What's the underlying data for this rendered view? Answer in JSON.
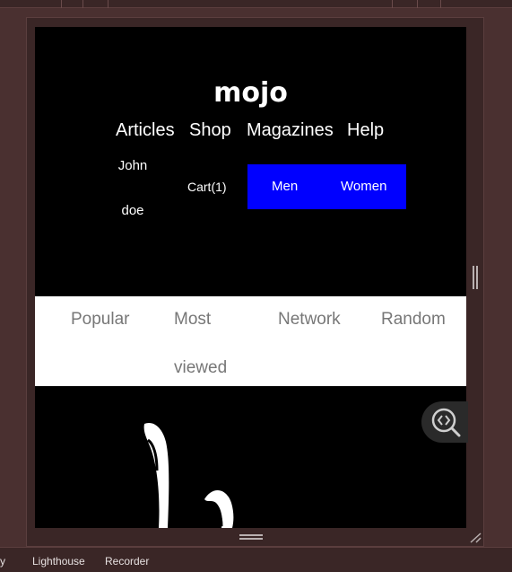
{
  "site": {
    "logo": "mojo",
    "nav": [
      "Articles",
      "Shop",
      "Magazines",
      "Help"
    ],
    "user_first": "John",
    "user_last": "doe",
    "cart": "Cart(1)",
    "gender": [
      "Men",
      "Women"
    ]
  },
  "tabs": {
    "popular": "Popular",
    "most": "Most",
    "viewed": "viewed",
    "network": "Network",
    "random": "Random"
  },
  "devtools": {
    "tabs": [
      "y",
      "Lighthouse",
      "Recorder"
    ]
  },
  "colors": {
    "header_bg": "#000000",
    "gender_bg": "#0000ff",
    "tabs_bg": "#ffffff",
    "tab_text": "#777777",
    "devtools_bg": "#4a3030"
  }
}
